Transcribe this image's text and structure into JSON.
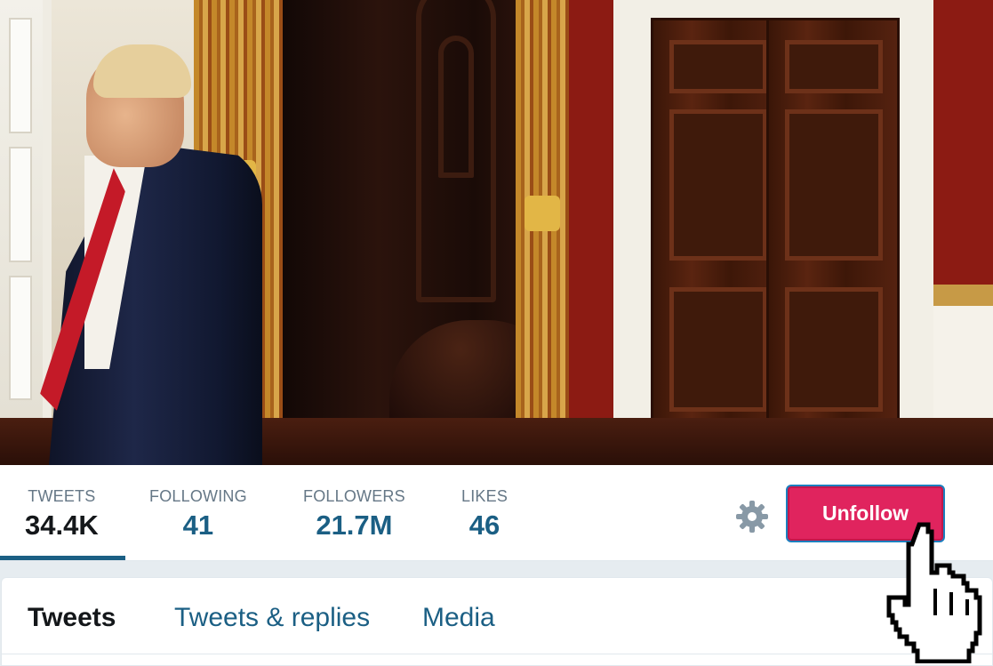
{
  "profile_nav": {
    "stats": [
      {
        "label": "TWEETS",
        "value": "34.4K"
      },
      {
        "label": "FOLLOWING",
        "value": "41"
      },
      {
        "label": "FOLLOWERS",
        "value": "21.7M"
      },
      {
        "label": "LIKES",
        "value": "46"
      }
    ],
    "settings_icon": "gear-icon",
    "unfollow_label": "Unfollow"
  },
  "timeline": {
    "tabs": [
      {
        "label": "Tweets"
      },
      {
        "label": "Tweets & replies"
      },
      {
        "label": "Media"
      }
    ]
  },
  "colors": {
    "accent": "#1b5f84",
    "unfollow": "#e0245e",
    "muted": "#657786"
  },
  "cursor_icon": "hand-pointer-icon"
}
